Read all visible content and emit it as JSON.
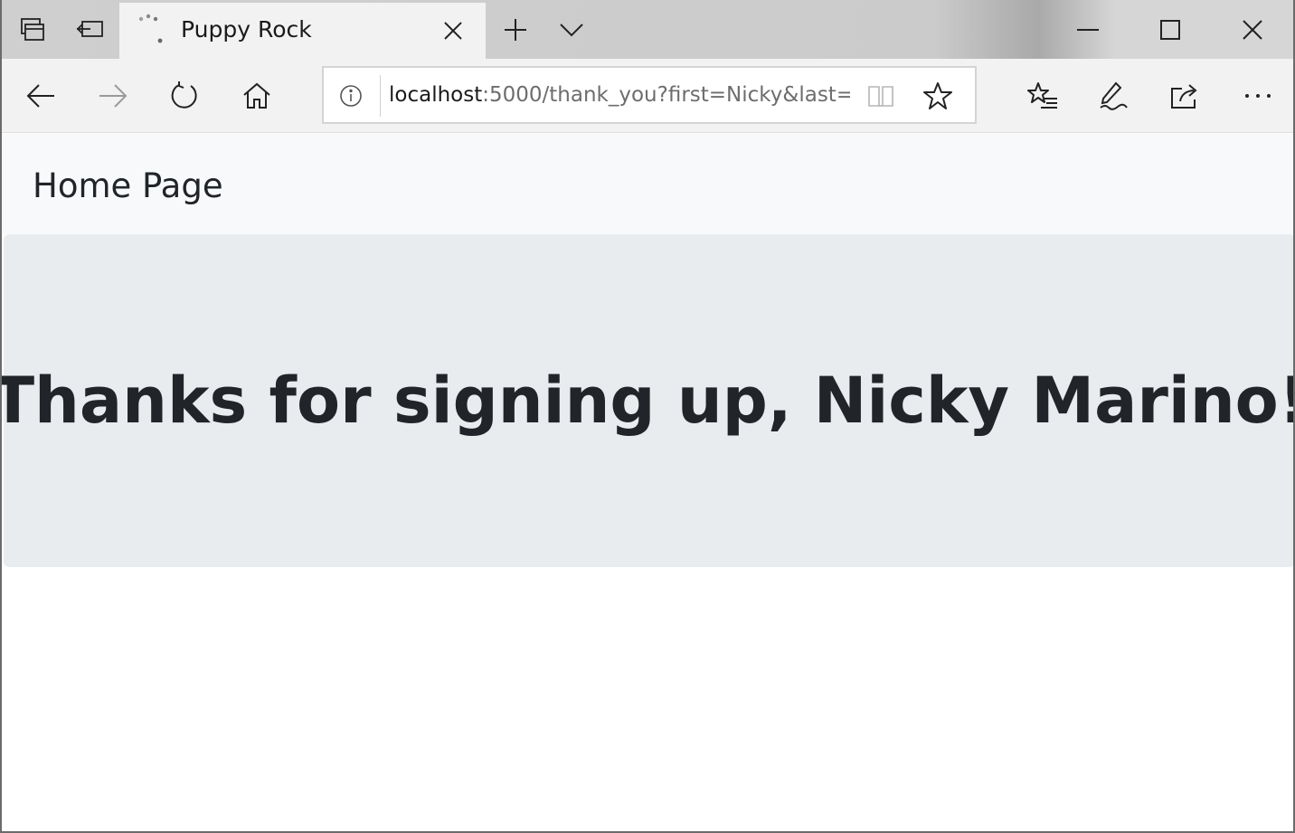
{
  "tab": {
    "title": "Puppy Rock"
  },
  "address_bar": {
    "host": "localhost",
    "path": ":5000/thank_you?first=Nicky&last="
  },
  "page": {
    "brand": "Home Page",
    "heading": "Thanks for signing up, Nicky Marino!"
  },
  "icons": {
    "titlebar_left": [
      "tabs-aside-icon",
      "set-aside-tabs-icon"
    ],
    "tab": [
      "loading-spinner-icon",
      "close-icon"
    ],
    "tab_actions": [
      "new-tab-icon",
      "chevron-down-icon"
    ],
    "window_controls": [
      "minimize-icon",
      "maximize-icon",
      "close-window-icon"
    ],
    "nav": [
      "back-icon",
      "forward-icon",
      "refresh-icon",
      "home-icon"
    ],
    "address": [
      "info-icon",
      "reading-view-icon",
      "favorite-star-icon"
    ],
    "toolbar_right": [
      "favorites-icon",
      "web-note-icon",
      "share-icon",
      "more-icon"
    ]
  },
  "colors": {
    "navbar_bg": "#f8f9fa",
    "jumbotron_bg": "#e9ecef",
    "text": "#212529"
  }
}
